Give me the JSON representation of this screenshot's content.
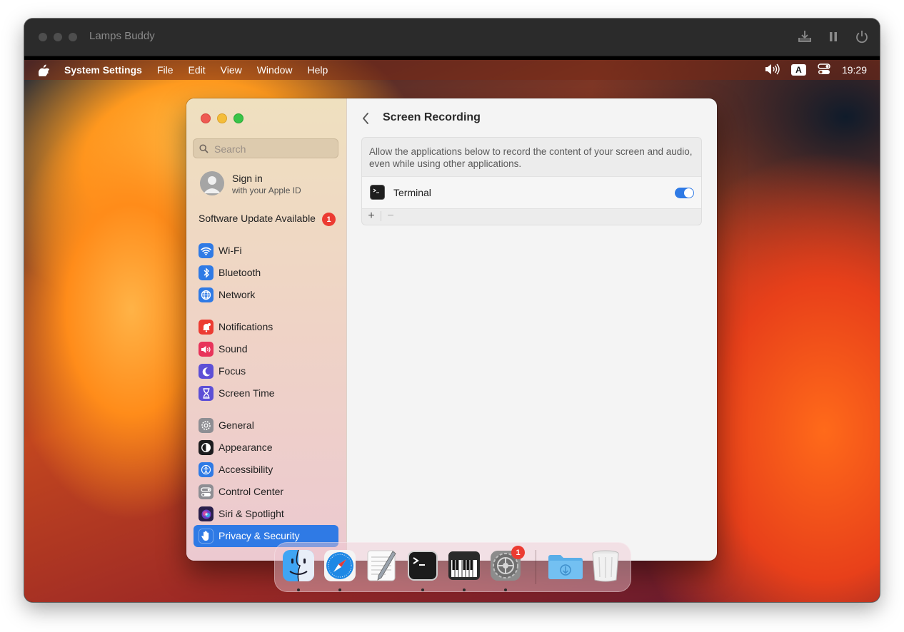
{
  "vm": {
    "title": "Lamps Buddy"
  },
  "menubar": {
    "app": "System Settings",
    "menus": [
      "File",
      "Edit",
      "View",
      "Window",
      "Help"
    ],
    "input_source": "A",
    "time": "19:29"
  },
  "sidebar": {
    "search_placeholder": "Search",
    "signin_title": "Sign in",
    "signin_subtitle": "with your Apple ID",
    "update_label": "Software Update Available",
    "update_badge": "1",
    "items": [
      {
        "label": "Wi-Fi",
        "icon": "wifi-icon",
        "color": "#2f7ae5"
      },
      {
        "label": "Bluetooth",
        "icon": "bluetooth-icon",
        "color": "#2f7ae5"
      },
      {
        "label": "Network",
        "icon": "globe-icon",
        "color": "#2f7ae5"
      },
      {
        "label": "Notifications",
        "icon": "bell-icon",
        "color": "#ec3b32"
      },
      {
        "label": "Sound",
        "icon": "speaker-icon",
        "color": "#e8335a"
      },
      {
        "label": "Focus",
        "icon": "moon-icon",
        "color": "#5d4fd6"
      },
      {
        "label": "Screen Time",
        "icon": "hourglass-icon",
        "color": "#5d4fd6"
      },
      {
        "label": "General",
        "icon": "gear-icon",
        "color": "#8e8e93"
      },
      {
        "label": "Appearance",
        "icon": "appearance-icon",
        "color": "#1c1c1e"
      },
      {
        "label": "Accessibility",
        "icon": "accessibility-icon",
        "color": "#2f7ae5"
      },
      {
        "label": "Control Center",
        "icon": "control-center-icon",
        "color": "#8e8e93"
      },
      {
        "label": "Siri & Spotlight",
        "icon": "siri-icon",
        "color": "#3a2a6a"
      },
      {
        "label": "Privacy & Security",
        "icon": "hand-icon",
        "color": "#2f7ae5",
        "selected": true
      }
    ]
  },
  "content": {
    "title": "Screen Recording",
    "description": "Allow the applications below to record the content of your screen and audio, even while using other applications.",
    "apps": [
      {
        "name": "Terminal",
        "enabled": true
      }
    ],
    "add_label": "+",
    "remove_label": "−"
  },
  "dock": {
    "apps": [
      "Finder",
      "Safari",
      "TextEdit",
      "Terminal",
      "Piano",
      "System Settings",
      "Downloads",
      "Trash"
    ],
    "settings_badge": "1"
  }
}
